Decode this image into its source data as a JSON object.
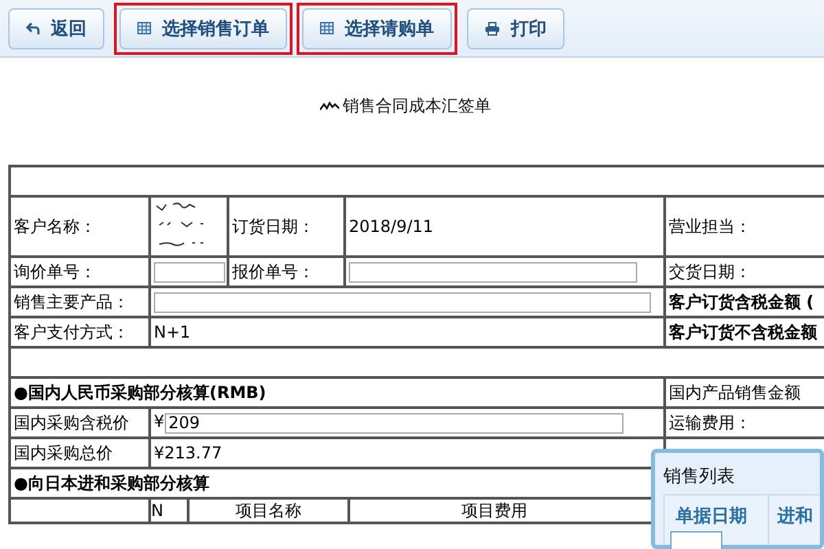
{
  "toolbar": {
    "buttons": [
      {
        "kind": "back",
        "label": "返回",
        "highlighted": false
      },
      {
        "kind": "grid",
        "label": "选择销售订单",
        "highlighted": true
      },
      {
        "kind": "grid",
        "label": "选择请购单",
        "highlighted": true
      },
      {
        "kind": "print",
        "label": "打印",
        "highlighted": false
      }
    ]
  },
  "title": "销售合同成本汇签单",
  "form": {
    "customer_name": {
      "label": "客户名称："
    },
    "order_date": {
      "label": "订货日期：",
      "value": "2018/9/11"
    },
    "sales_rep": {
      "label": "营业担当："
    },
    "inquiry_no": {
      "label": "询价单号："
    },
    "quote_no": {
      "label": "报价单号："
    },
    "delivery_date": {
      "label": "交货日期："
    },
    "main_product": {
      "label": "销售主要产品："
    },
    "amount_incl_tax": {
      "label": "客户订货含税金额 ("
    },
    "payment": {
      "label": "客户支付方式：",
      "value": "N+1"
    },
    "amount_excl_tax": {
      "label": "客户订货不含税金额"
    },
    "domestic": {
      "heading": "●国内人民币采购部分核算(RMB)",
      "side_label": "国内产品销售金额"
    },
    "price_incl_tax": {
      "label": "国内采购含税价",
      "currency": "¥",
      "value": "209"
    },
    "shipping": {
      "label": "运输费用："
    },
    "total": {
      "label": "国内采购总价",
      "value": "¥213.77"
    },
    "japan": {
      "heading": "●向日本进和采购部分核算",
      "columns": [
        "N",
        "项目名称",
        "项目费用"
      ]
    }
  },
  "popup": {
    "title": "销售列表",
    "columns": [
      "单据日期",
      "进和"
    ]
  }
}
